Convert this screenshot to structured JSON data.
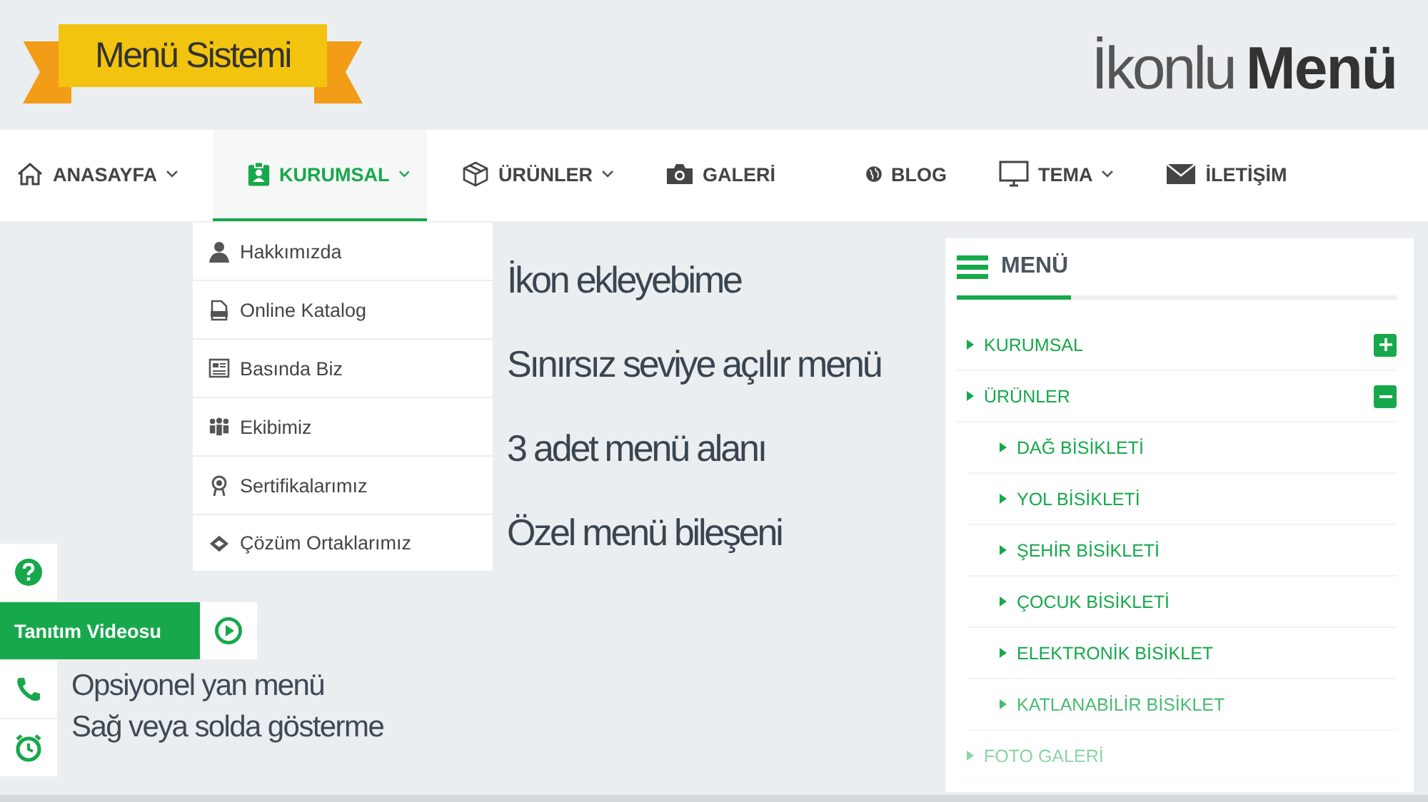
{
  "banner": {
    "title": "Menü Sistemi"
  },
  "logo": {
    "light": "İkonlu",
    "bold": "Menü"
  },
  "nav": [
    {
      "label": "ANASAYFA",
      "selected": false,
      "has_submenu": true
    },
    {
      "label": "KURUMSAL",
      "selected": true,
      "has_submenu": true
    },
    {
      "label": "ÜRÜNLER",
      "selected": false,
      "has_submenu": true
    },
    {
      "label": "GALERİ",
      "selected": false,
      "has_submenu": false
    },
    {
      "label": "BLOG",
      "selected": false,
      "has_submenu": false
    },
    {
      "label": "TEMA",
      "selected": false,
      "has_submenu": true
    },
    {
      "label": "İLETİŞİM",
      "selected": false,
      "has_submenu": false
    }
  ],
  "dropdown": [
    "Hakkımızda",
    "Online Katalog",
    "Basında Biz",
    "Ekibimiz",
    "Sertifikalarımız",
    "Çözüm Ortaklarımız"
  ],
  "features": [
    "İkon ekleyebime",
    "Sınırsız seviye açılır menü",
    "3 adet menü alanı",
    "Özel menü bileşeni"
  ],
  "side_bar": {
    "video_label": "Tanıtım Videosu"
  },
  "side_text": [
    "Opsiyonel yan menü",
    "Sağ veya solda gösterme"
  ],
  "side_menu": {
    "title": "MENÜ",
    "items": [
      {
        "label": "KURUMSAL",
        "expanded": false
      },
      {
        "label": "ÜRÜNLER",
        "expanded": true,
        "children": [
          {
            "label": "DAĞ BİSİKLETİ"
          },
          {
            "label": "YOL BİSİKLETİ"
          },
          {
            "label": "ŞEHİR BİSİKLETİ"
          },
          {
            "label": "ÇOCUK BİSİKLETİ"
          },
          {
            "label": "ELEKTRONİK BİSİKLET"
          },
          {
            "label": "KATLANABİLİR BİSİKLET"
          }
        ]
      },
      {
        "label": "FOTO GALERİ"
      }
    ]
  }
}
